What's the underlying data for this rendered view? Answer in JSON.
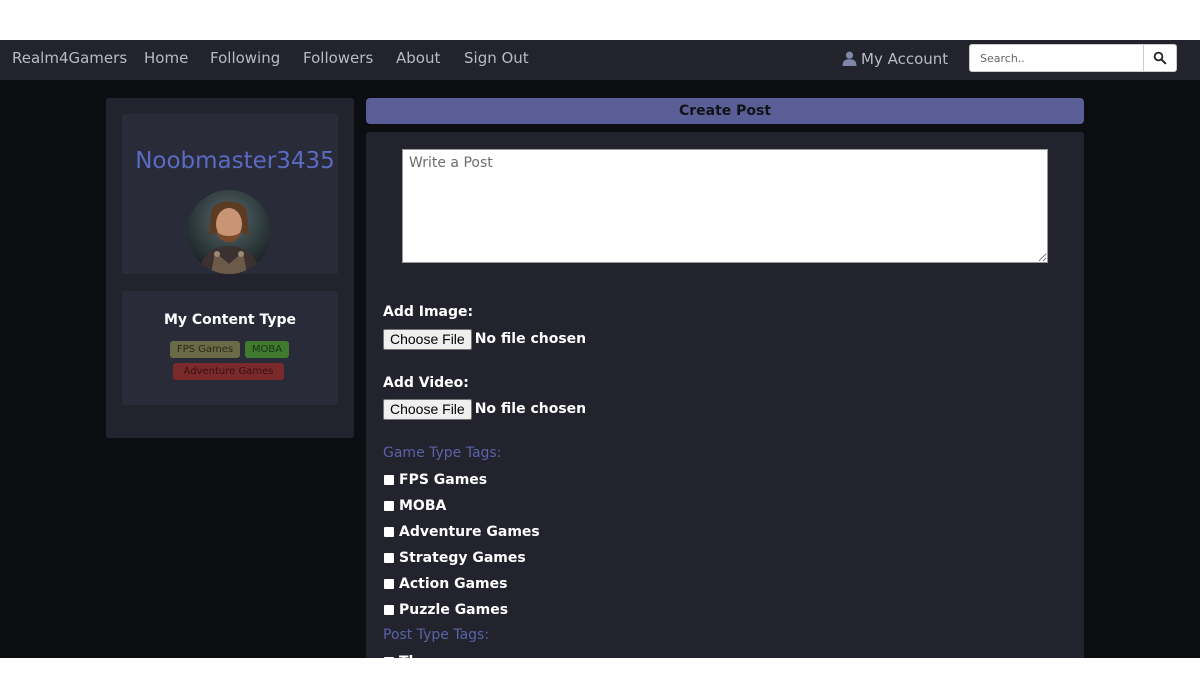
{
  "navbar": {
    "brand": "Realm4Gamers",
    "links": [
      "Home",
      "Following",
      "Followers",
      "About",
      "Sign Out"
    ],
    "account_label": "My Account",
    "search_placeholder": "Search.."
  },
  "sidebar": {
    "username": "Noobmaster3435",
    "content_type_title": "My Content Type",
    "tags": [
      {
        "label": "FPS Games",
        "bg": "#6b6a47",
        "fg": "#2b2a16"
      },
      {
        "label": "MOBA",
        "bg": "#3f7a2e",
        "fg": "#1a3312"
      },
      {
        "label": "Adventure Games",
        "bg": "#7a2a2a",
        "fg": "#3a1010"
      }
    ]
  },
  "main": {
    "header": "Create Post",
    "textarea_placeholder": "Write a Post",
    "add_image_label": "Add Image:",
    "add_video_label": "Add Video:",
    "choose_file_label": "Choose File",
    "no_file_text": "No file chosen",
    "game_type_heading": "Game Type Tags:",
    "game_types": [
      "FPS Games",
      "MOBA",
      "Adventure Games",
      "Strategy Games",
      "Action Games",
      "Puzzle Games"
    ],
    "post_type_heading": "Post Type Tags:",
    "post_types": [
      "Th"
    ]
  },
  "colors": {
    "accent": "#5a6bc2",
    "navbar_bg": "#22232c",
    "page_bg": "#0d0e12",
    "card_bg": "#22232d"
  }
}
